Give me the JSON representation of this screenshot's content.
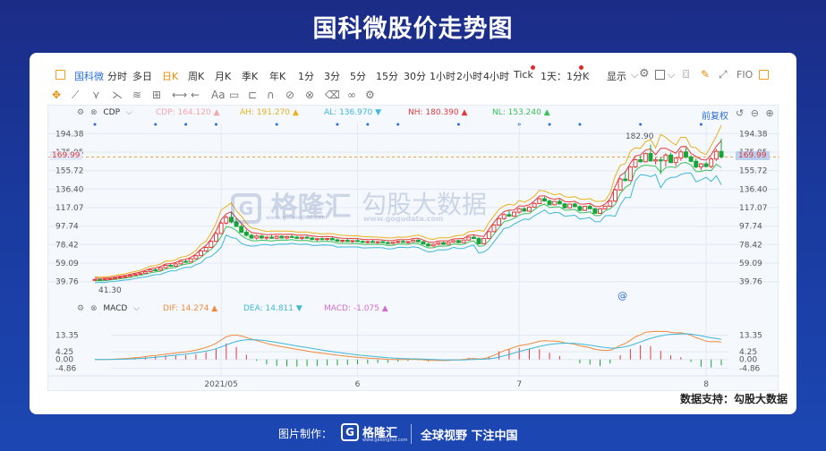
{
  "page_title": "国科微股价走势图",
  "toolbar": {
    "periods": [
      "国科微",
      "分时",
      "多日",
      "日K",
      "周K",
      "月K",
      "季K",
      "年K",
      "1分",
      "3分",
      "5分",
      "15分",
      "30分",
      "1小时",
      "2小时",
      "4小时",
      "Tick",
      "1天：1分K"
    ],
    "active_stock": "国科微",
    "active_period": "日K",
    "display_label": "显示",
    "fio_label": "FIO"
  },
  "draw_tools": {
    "text_tool": "Aa"
  },
  "indicators": {
    "main": {
      "name": "CDP",
      "items": [
        {
          "label": "CDP: 164.120",
          "color": "#f4a6a8",
          "arrow": "▲"
        },
        {
          "label": "AH: 191.270",
          "color": "#e9b21b",
          "arrow": "▲"
        },
        {
          "label": "AL: 136.970",
          "color": "#3fb8d8",
          "arrow": "▼"
        },
        {
          "label": "NH: 180.390",
          "color": "#e23a3a",
          "arrow": "▲"
        },
        {
          "label": "NL: 153.240",
          "color": "#3bbf5a",
          "arrow": "▲"
        }
      ],
      "right_label": "前复权"
    },
    "sub": {
      "name": "MACD",
      "items": [
        {
          "label": "DIF: 14.274",
          "color": "#f08a3c",
          "arrow": "▲"
        },
        {
          "label": "DEA: 14.811",
          "color": "#3fb8d8",
          "arrow": "▼"
        },
        {
          "label": "MACD: -1.075",
          "color": "#d36bd0",
          "arrow": "▲"
        }
      ]
    }
  },
  "annotations": {
    "high_label": "182.90",
    "low_label": "41.30",
    "current_price": "169.99"
  },
  "watermarks": {
    "brand": "格隆汇",
    "brand_url": "www.gelonghui.com",
    "source": "勾股大数据",
    "source_url": "www.gogudata.com"
  },
  "data_source": "数据支持：勾股大数据",
  "bottom": {
    "credit": "图片制作：",
    "logo": "格隆汇",
    "logo_url": "www.gelonghui.com",
    "slogan": "全球视野 下注中国"
  },
  "chart_data": [
    {
      "type": "candlestick",
      "title": "",
      "y_ticks": [
        194.38,
        175.05,
        155.72,
        136.4,
        117.07,
        97.74,
        78.42,
        59.09,
        39.76
      ],
      "ylim": [
        32,
        205
      ],
      "x_tick_labels": [
        {
          "label": "2021/05",
          "index": 25
        },
        {
          "label": "6",
          "index": 52
        },
        {
          "label": "7",
          "index": 84
        },
        {
          "label": "8",
          "index": 121
        }
      ],
      "bars": [
        [
          41.5,
          42.4,
          40.8,
          42.0
        ],
        [
          42.0,
          42.6,
          41.3,
          41.6
        ],
        [
          41.6,
          42.8,
          41.3,
          42.5
        ],
        [
          42.5,
          43.3,
          42.0,
          42.8
        ],
        [
          42.8,
          44.0,
          42.5,
          43.8
        ],
        [
          43.8,
          44.8,
          43.2,
          44.5
        ],
        [
          44.5,
          45.5,
          43.9,
          45.2
        ],
        [
          45.2,
          46.8,
          44.8,
          46.4
        ],
        [
          46.4,
          47.9,
          46.0,
          47.5
        ],
        [
          47.5,
          49.0,
          47.0,
          48.6
        ],
        [
          48.6,
          50.8,
          48.2,
          50.3
        ],
        [
          50.3,
          52.7,
          49.8,
          52.1
        ],
        [
          52.1,
          53.8,
          51.2,
          51.8
        ],
        [
          51.8,
          54.6,
          51.4,
          54.2
        ],
        [
          54.2,
          57.3,
          53.8,
          56.8
        ],
        [
          56.8,
          58.2,
          55.4,
          55.9
        ],
        [
          55.9,
          58.8,
          55.5,
          58.3
        ],
        [
          58.3,
          61.4,
          57.9,
          60.9
        ],
        [
          60.9,
          63.0,
          59.8,
          60.3
        ],
        [
          60.3,
          64.2,
          60.0,
          63.6
        ],
        [
          63.6,
          67.5,
          63.1,
          66.9
        ],
        [
          66.9,
          72.5,
          66.4,
          71.8
        ],
        [
          71.8,
          76.3,
          71.0,
          75.5
        ],
        [
          75.5,
          82.9,
          75.0,
          81.9
        ],
        [
          81.9,
          91.2,
          81.2,
          90.0
        ],
        [
          90.0,
          102.4,
          89.3,
          100.9
        ],
        [
          100.9,
          108.8,
          99.4,
          106.9
        ],
        [
          106.9,
          112.5,
          100.6,
          102.1
        ],
        [
          102.1,
          106.0,
          96.8,
          97.4
        ],
        [
          97.4,
          99.6,
          90.5,
          91.4
        ],
        [
          91.4,
          94.0,
          86.8,
          88.2
        ],
        [
          88.2,
          89.6,
          84.0,
          85.4
        ],
        [
          85.4,
          88.8,
          83.6,
          87.4
        ],
        [
          87.4,
          88.6,
          84.6,
          85.3
        ],
        [
          85.3,
          87.0,
          83.4,
          86.2
        ],
        [
          86.2,
          88.5,
          84.4,
          85.1
        ],
        [
          85.1,
          87.9,
          84.2,
          87.0
        ],
        [
          87.0,
          88.2,
          84.7,
          85.4
        ],
        [
          85.4,
          87.6,
          84.0,
          86.8
        ],
        [
          86.8,
          88.8,
          85.6,
          86.2
        ],
        [
          86.2,
          87.5,
          84.3,
          85.0
        ],
        [
          85.0,
          86.8,
          83.5,
          86.1
        ],
        [
          86.1,
          87.8,
          84.6,
          85.2
        ],
        [
          85.2,
          86.4,
          83.0,
          83.8
        ],
        [
          83.8,
          85.2,
          82.0,
          84.6
        ],
        [
          84.6,
          86.0,
          83.2,
          83.9
        ],
        [
          83.9,
          85.4,
          82.4,
          84.8
        ],
        [
          84.8,
          86.6,
          83.6,
          83.4
        ],
        [
          83.4,
          84.6,
          81.2,
          82.0
        ],
        [
          82.0,
          83.6,
          80.5,
          82.9
        ],
        [
          82.9,
          84.4,
          81.4,
          81.7
        ],
        [
          81.7,
          83.1,
          80.2,
          82.6
        ],
        [
          82.6,
          84.2,
          81.3,
          81.8
        ],
        [
          81.8,
          83.0,
          80.0,
          80.8
        ],
        [
          80.8,
          82.5,
          79.6,
          81.6
        ],
        [
          81.6,
          83.2,
          80.4,
          80.9
        ],
        [
          80.9,
          82.0,
          79.3,
          81.4
        ],
        [
          81.4,
          82.8,
          80.2,
          80.4
        ],
        [
          80.4,
          81.7,
          78.8,
          79.6
        ],
        [
          79.6,
          81.4,
          78.5,
          80.9
        ],
        [
          80.9,
          82.6,
          80.0,
          81.7
        ],
        [
          81.7,
          83.4,
          80.9,
          80.8
        ],
        [
          80.8,
          82.0,
          79.2,
          81.5
        ],
        [
          81.5,
          83.8,
          81.0,
          83.1
        ],
        [
          83.1,
          84.2,
          80.8,
          81.4
        ],
        [
          81.4,
          82.4,
          78.6,
          79.0
        ],
        [
          79.0,
          80.3,
          76.5,
          77.1
        ],
        [
          77.1,
          79.6,
          76.2,
          78.8
        ],
        [
          78.8,
          81.2,
          78.0,
          80.4
        ],
        [
          80.4,
          81.6,
          78.2,
          78.8
        ],
        [
          78.8,
          81.5,
          78.4,
          81.0
        ],
        [
          81.0,
          83.3,
          80.4,
          82.6
        ],
        [
          82.6,
          83.6,
          79.9,
          80.5
        ],
        [
          80.5,
          83.8,
          80.0,
          83.2
        ],
        [
          83.2,
          86.9,
          82.6,
          86.2
        ],
        [
          86.2,
          88.1,
          84.2,
          84.8
        ],
        [
          84.8,
          86.2,
          78.6,
          79.3
        ],
        [
          79.3,
          85.6,
          78.8,
          84.8
        ],
        [
          84.8,
          92.8,
          84.2,
          92.0
        ],
        [
          92.0,
          99.8,
          91.2,
          98.9
        ],
        [
          98.9,
          106.5,
          98.1,
          105.6
        ],
        [
          105.6,
          111.2,
          104.2,
          109.8
        ],
        [
          109.8,
          114.6,
          107.4,
          108.2
        ],
        [
          108.2,
          113.0,
          107.6,
          112.4
        ],
        [
          112.4,
          117.0,
          110.8,
          115.9
        ],
        [
          115.9,
          117.5,
          112.9,
          113.4
        ],
        [
          113.4,
          118.5,
          112.8,
          117.6
        ],
        [
          117.6,
          122.5,
          116.9,
          121.4
        ],
        [
          121.4,
          127.3,
          120.6,
          126.4
        ],
        [
          126.4,
          128.6,
          123.4,
          124.0
        ],
        [
          124.0,
          125.4,
          119.4,
          120.1
        ],
        [
          120.1,
          124.2,
          119.5,
          123.6
        ],
        [
          123.6,
          125.8,
          120.4,
          121.0
        ],
        [
          121.0,
          121.8,
          116.2,
          116.8
        ],
        [
          116.8,
          121.4,
          116.3,
          120.8
        ],
        [
          120.8,
          122.6,
          117.5,
          118.2
        ],
        [
          118.2,
          119.4,
          113.6,
          114.2
        ],
        [
          114.2,
          119.0,
          113.6,
          118.4
        ],
        [
          118.4,
          120.6,
          115.2,
          115.9
        ],
        [
          115.9,
          116.5,
          110.4,
          111.2
        ],
        [
          111.2,
          116.6,
          110.6,
          115.8
        ],
        [
          115.8,
          119.1,
          115.2,
          118.6
        ],
        [
          118.6,
          124.5,
          117.8,
          123.9
        ],
        [
          123.9,
          136.8,
          123.1,
          135.6
        ],
        [
          135.6,
          148.0,
          134.8,
          146.9
        ],
        [
          146.9,
          155.4,
          144.6,
          145.4
        ],
        [
          145.4,
          160.5,
          144.8,
          159.6
        ],
        [
          159.6,
          168.5,
          158.4,
          167.2
        ],
        [
          167.2,
          171.5,
          164.2,
          165.0
        ],
        [
          165.0,
          174.5,
          164.3,
          173.6
        ],
        [
          173.6,
          182.9,
          171.2,
          165.8
        ],
        [
          165.8,
          169.4,
          162.0,
          167.0
        ],
        [
          167.0,
          170.2,
          152.0,
          166.0
        ],
        [
          166.0,
          174.0,
          160.0,
          172.0
        ],
        [
          172.0,
          174.5,
          163.4,
          164.2
        ],
        [
          164.2,
          170.2,
          160.5,
          168.8
        ],
        [
          168.8,
          177.6,
          166.0,
          175.3
        ],
        [
          175.3,
          179.5,
          168.5,
          170.0
        ],
        [
          170.0,
          171.9,
          164.6,
          165.5
        ],
        [
          165.5,
          168.8,
          158.2,
          159.6
        ],
        [
          159.6,
          163.8,
          156.0,
          162.8
        ],
        [
          162.8,
          165.0,
          159.0,
          160.1
        ],
        [
          160.1,
          169.4,
          158.2,
          167.9
        ],
        [
          167.9,
          178.4,
          165.8,
          175.8
        ],
        [
          175.8,
          189.0,
          168.4,
          169.99
        ]
      ],
      "overlays": [
        {
          "name": "AH",
          "color": "#e9b21b"
        },
        {
          "name": "NH",
          "color": "#e23a3a"
        },
        {
          "name": "NL",
          "color": "#3bbf5a"
        },
        {
          "name": "AL",
          "color": "#3fb8d8"
        }
      ]
    },
    {
      "type": "macd",
      "y_ticks": [
        13.35,
        4.25,
        0.0,
        -4.86
      ],
      "ylim": [
        -7,
        19
      ]
    }
  ]
}
